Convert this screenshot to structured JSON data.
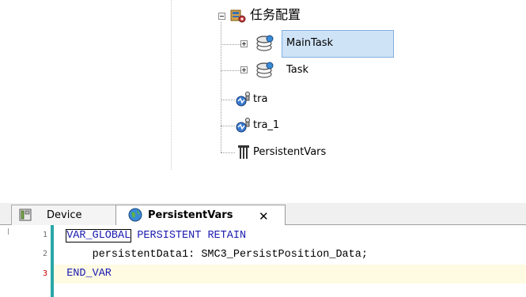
{
  "tree": {
    "root_label": "任务配置",
    "nodes": [
      {
        "label": "MainTask",
        "selected": true,
        "icon": "task-config-icon"
      },
      {
        "label": "Task",
        "selected": false,
        "icon": "task-config-icon"
      },
      {
        "label": "tra",
        "icon": "trace-icon"
      },
      {
        "label": "tra_1",
        "icon": "trace-icon"
      },
      {
        "label": "PersistentVars",
        "icon": "persistent-vars-icon"
      }
    ]
  },
  "tabs": [
    {
      "label": "Device",
      "icon": "device-icon",
      "active": false
    },
    {
      "label": "PersistentVars",
      "icon": "globe-icon",
      "active": true,
      "close": "✕"
    }
  ],
  "code": {
    "line_numbers": [
      "1",
      "2",
      "3"
    ],
    "line1": {
      "kw1": "VAR_GLOBAL",
      "kw2": "PERSISTENT RETAIN"
    },
    "line2": {
      "text": "persistentData1: SMC3_PersistPosition_Data;"
    },
    "line3": {
      "kw": "END_VAR"
    }
  },
  "colors": {
    "keyword": "#1a1ab0",
    "selection": "#cfe3f7",
    "current_line": "#fffbe3",
    "gutter_bar": "#2aa6a6",
    "error_line_number": "#cc0000"
  }
}
